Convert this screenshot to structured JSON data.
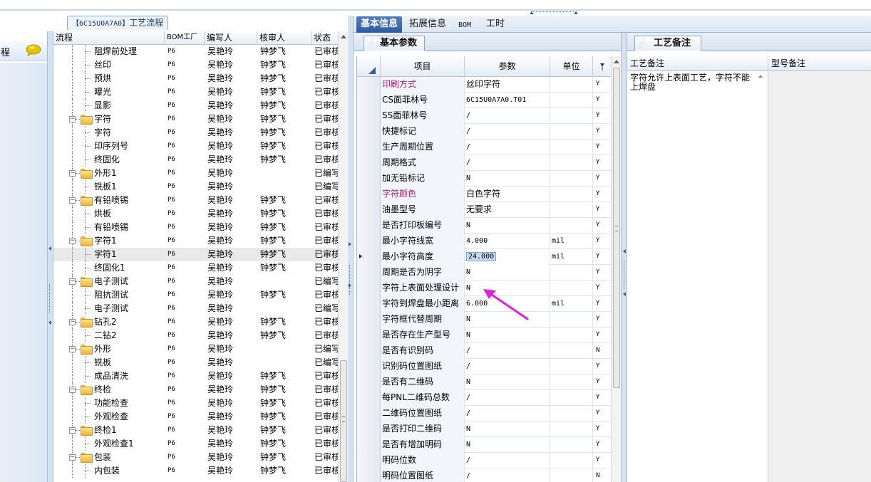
{
  "tree_panel": {
    "title_code": "【6C15U0A7A0】",
    "title_label": "工艺流程"
  },
  "left_mini": {
    "item_label": "程",
    "item_icon": "chat-bubble-icon"
  },
  "tree": {
    "columns": [
      "流程",
      "BOM工厂",
      "编写人",
      "核审人",
      "状态"
    ],
    "rows": [
      {
        "name": "阻焊前处理",
        "level": 1,
        "folder": false,
        "bom": "P6",
        "writer": "吴艳玲",
        "reviewer": "钟梦飞",
        "status": "已审核"
      },
      {
        "name": "丝印",
        "level": 1,
        "folder": false,
        "bom": "P6",
        "writer": "吴艳玲",
        "reviewer": "钟梦飞",
        "status": "已审核"
      },
      {
        "name": "预烘",
        "level": 1,
        "folder": false,
        "bom": "P6",
        "writer": "吴艳玲",
        "reviewer": "钟梦飞",
        "status": "已审核"
      },
      {
        "name": "曝光",
        "level": 1,
        "folder": false,
        "bom": "P6",
        "writer": "吴艳玲",
        "reviewer": "钟梦飞",
        "status": "已审核"
      },
      {
        "name": "显影",
        "level": 1,
        "folder": false,
        "bom": "P6",
        "writer": "吴艳玲",
        "reviewer": "钟梦飞",
        "status": "已审核"
      },
      {
        "name": "字符",
        "level": 0,
        "folder": true,
        "bom": "P6",
        "writer": "吴艳玲",
        "reviewer": "钟梦飞",
        "status": "已审核"
      },
      {
        "name": "字符",
        "level": 1,
        "folder": false,
        "bom": "P6",
        "writer": "吴艳玲",
        "reviewer": "钟梦飞",
        "status": "已审核"
      },
      {
        "name": "印序列号",
        "level": 1,
        "folder": false,
        "bom": "P6",
        "writer": "吴艳玲",
        "reviewer": "钟梦飞",
        "status": "已审核"
      },
      {
        "name": "终固化",
        "level": 1,
        "folder": false,
        "bom": "P6",
        "writer": "吴艳玲",
        "reviewer": "钟梦飞",
        "status": "已审核"
      },
      {
        "name": "外形1",
        "level": 0,
        "folder": true,
        "bom": "P6",
        "writer": "吴艳玲",
        "reviewer": "",
        "status": "已编写"
      },
      {
        "name": "铣板1",
        "level": 1,
        "folder": false,
        "bom": "P6",
        "writer": "吴艳玲",
        "reviewer": "",
        "status": "已编写"
      },
      {
        "name": "有铅喷锡",
        "level": 0,
        "folder": true,
        "bom": "P6",
        "writer": "吴艳玲",
        "reviewer": "钟梦飞",
        "status": "已审核"
      },
      {
        "name": "烘板",
        "level": 1,
        "folder": false,
        "bom": "P6",
        "writer": "吴艳玲",
        "reviewer": "钟梦飞",
        "status": "已审核"
      },
      {
        "name": "有铅喷锡",
        "level": 1,
        "folder": false,
        "bom": "P6",
        "writer": "吴艳玲",
        "reviewer": "钟梦飞",
        "status": "已审核"
      },
      {
        "name": "字符1",
        "level": 0,
        "folder": true,
        "bom": "P6",
        "writer": "吴艳玲",
        "reviewer": "钟梦飞",
        "status": "已审核"
      },
      {
        "name": "字符1",
        "level": 1,
        "folder": false,
        "bom": "P6",
        "writer": "吴艳玲",
        "reviewer": "钟梦飞",
        "status": "已审核",
        "selected": true
      },
      {
        "name": "终固化1",
        "level": 1,
        "folder": false,
        "bom": "P6",
        "writer": "吴艳玲",
        "reviewer": "钟梦飞",
        "status": "已审核"
      },
      {
        "name": "电子测试",
        "level": 0,
        "folder": true,
        "bom": "P6",
        "writer": "吴艳玲",
        "reviewer": "",
        "status": "已编写"
      },
      {
        "name": "阻抗测试",
        "level": 1,
        "folder": false,
        "bom": "P6",
        "writer": "吴艳玲",
        "reviewer": "钟梦飞",
        "status": "已审核"
      },
      {
        "name": "电子测试",
        "level": 1,
        "folder": false,
        "bom": "P6",
        "writer": "吴艳玲",
        "reviewer": "",
        "status": "已编写"
      },
      {
        "name": "钻孔2",
        "level": 0,
        "folder": true,
        "bom": "P6",
        "writer": "吴艳玲",
        "reviewer": "钟梦飞",
        "status": "已审核"
      },
      {
        "name": "二钻2",
        "level": 1,
        "folder": false,
        "bom": "P6",
        "writer": "吴艳玲",
        "reviewer": "钟梦飞",
        "status": "已审核"
      },
      {
        "name": "外形",
        "level": 0,
        "folder": true,
        "bom": "P6",
        "writer": "吴艳玲",
        "reviewer": "",
        "status": "已编写"
      },
      {
        "name": "铣板",
        "level": 1,
        "folder": false,
        "bom": "P6",
        "writer": "吴艳玲",
        "reviewer": "",
        "status": "已编写"
      },
      {
        "name": "成品清洗",
        "level": 1,
        "folder": false,
        "bom": "P6",
        "writer": "吴艳玲",
        "reviewer": "钟梦飞",
        "status": "已审核"
      },
      {
        "name": "终检",
        "level": 0,
        "folder": true,
        "bom": "P6",
        "writer": "吴艳玲",
        "reviewer": "钟梦飞",
        "status": "已审核"
      },
      {
        "name": "功能检查",
        "level": 1,
        "folder": false,
        "bom": "P6",
        "writer": "吴艳玲",
        "reviewer": "钟梦飞",
        "status": "已审核"
      },
      {
        "name": "外观检查",
        "level": 1,
        "folder": false,
        "bom": "P6",
        "writer": "吴艳玲",
        "reviewer": "钟梦飞",
        "status": "已审核"
      },
      {
        "name": "终检1",
        "level": 0,
        "folder": true,
        "bom": "P6",
        "writer": "吴艳玲",
        "reviewer": "钟梦飞",
        "status": "已审核"
      },
      {
        "name": "外观检查1",
        "level": 1,
        "folder": false,
        "bom": "P6",
        "writer": "吴艳玲",
        "reviewer": "钟梦飞",
        "status": "已审核"
      },
      {
        "name": "包装",
        "level": 0,
        "folder": true,
        "bom": "P6",
        "writer": "吴艳玲",
        "reviewer": "钟梦飞",
        "status": "已审核"
      },
      {
        "name": "内包装",
        "level": 1,
        "folder": false,
        "bom": "P6",
        "writer": "吴艳玲",
        "reviewer": "钟梦飞",
        "status": "已审核"
      }
    ]
  },
  "main_tabs": [
    {
      "label": "基本信息",
      "active": true
    },
    {
      "label": "拓展信息",
      "active": false
    },
    {
      "label": "BOM",
      "active": false
    },
    {
      "label": "工时",
      "active": false
    }
  ],
  "params_panel": {
    "tab_label": "基本参数",
    "columns": [
      "项目",
      "参数",
      "单位"
    ],
    "highlight_color": "#b0206e",
    "rows": [
      {
        "item": "印刷方式",
        "value": "丝印字符",
        "unit": "",
        "req": "Y",
        "highlight": true
      },
      {
        "item": "CS面菲林号",
        "value": "6C15U0A7A0.T01",
        "unit": "",
        "req": "Y"
      },
      {
        "item": "SS面菲林号",
        "value": "/",
        "unit": "",
        "req": "Y"
      },
      {
        "item": "快捷标记",
        "value": "/",
        "unit": "",
        "req": "Y"
      },
      {
        "item": "生产周期位置",
        "value": "/",
        "unit": "",
        "req": "Y"
      },
      {
        "item": "周期格式",
        "value": "/",
        "unit": "",
        "req": "Y"
      },
      {
        "item": "加无铅标记",
        "value": "N",
        "unit": "",
        "req": "Y"
      },
      {
        "item": "字符颜色",
        "value": "白色字符",
        "unit": "",
        "req": "Y",
        "highlight": true
      },
      {
        "item": "油墨型号",
        "value": "无要求",
        "unit": "",
        "req": "Y"
      },
      {
        "item": "是否打印板编号",
        "value": "N",
        "unit": "",
        "req": "Y"
      },
      {
        "item": "最小字符线宽",
        "value": "4.000",
        "unit": "mil",
        "req": "Y"
      },
      {
        "item": "最小字符高度",
        "value": "24.000",
        "unit": "mil",
        "req": "Y",
        "current": true
      },
      {
        "item": "周期是否为阴字",
        "value": "N",
        "unit": "",
        "req": "Y"
      },
      {
        "item": "字符上表面处理设计",
        "value": "N",
        "unit": "",
        "req": "Y"
      },
      {
        "item": "字符到焊盘最小距离",
        "value": "6.000",
        "unit": "mil",
        "req": "Y"
      },
      {
        "item": "字符框代替周期",
        "value": "N",
        "unit": "",
        "req": "Y"
      },
      {
        "item": "是否存在生产型号",
        "value": "N",
        "unit": "",
        "req": "Y"
      },
      {
        "item": "是否有识别码",
        "value": "/",
        "unit": "",
        "req": "N"
      },
      {
        "item": "识别码位置图纸",
        "value": "/",
        "unit": "",
        "req": "Y"
      },
      {
        "item": "是否有二维码",
        "value": "N",
        "unit": "",
        "req": "Y"
      },
      {
        "item": "每PNL二维码总数",
        "value": "/",
        "unit": "",
        "req": "Y"
      },
      {
        "item": "二维码位置图纸",
        "value": "/",
        "unit": "",
        "req": "Y"
      },
      {
        "item": "是否打印二维码",
        "value": "N",
        "unit": "",
        "req": "Y"
      },
      {
        "item": "是否有增加明码",
        "value": "N",
        "unit": "",
        "req": "Y"
      },
      {
        "item": "明码位数",
        "value": "/",
        "unit": "",
        "req": "Y"
      },
      {
        "item": "明码位置图纸",
        "value": "/",
        "unit": "",
        "req": "N"
      }
    ]
  },
  "notes_panel": {
    "tab_label": "工艺备注",
    "columns": [
      "工艺备注",
      "型号备注"
    ],
    "process_note": "字符允许上表面工艺，字符不能上焊盘",
    "model_note": ""
  },
  "colors": {
    "accent_tab": "#3a68a9",
    "annotation_arrow": "#e020d8"
  }
}
